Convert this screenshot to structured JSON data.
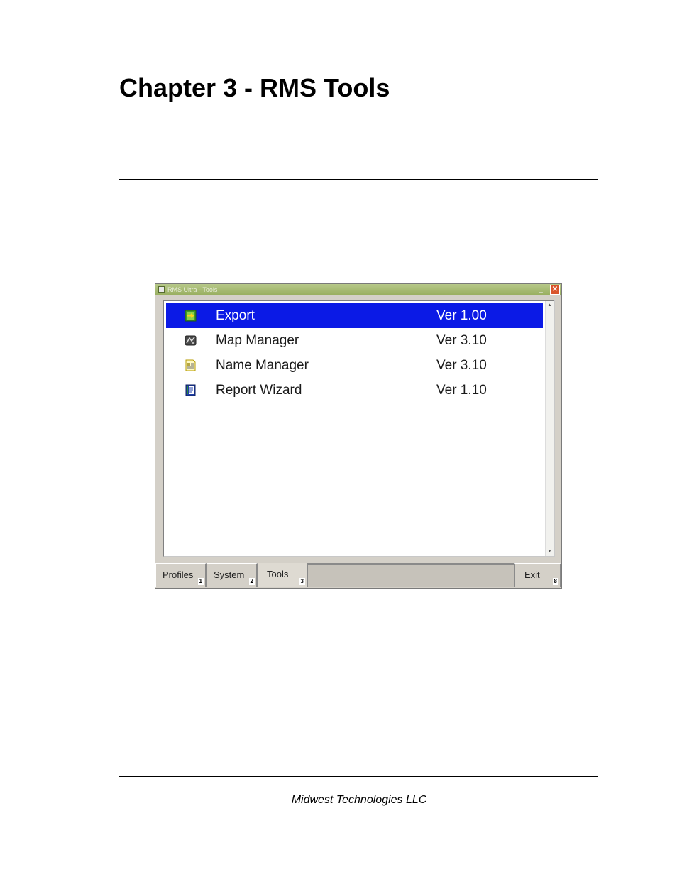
{
  "chapter": {
    "title": "Chapter 3 - RMS Tools"
  },
  "footer": {
    "text": "Midwest Technologies LLC"
  },
  "window": {
    "title": "RMS Ultra - Tools",
    "minimize_glyph": "_",
    "close_glyph": "✕",
    "accent_color": "#0b1ae6",
    "tools": [
      {
        "name": "Export",
        "version": "Ver 1.00",
        "icon": "export-icon",
        "selected": true
      },
      {
        "name": "Map Manager",
        "version": "Ver 3.10",
        "icon": "map-manager-icon",
        "selected": false
      },
      {
        "name": "Name Manager",
        "version": "Ver 3.10",
        "icon": "name-manager-icon",
        "selected": false
      },
      {
        "name": "Report Wizard",
        "version": "Ver 1.10",
        "icon": "report-wizard-icon",
        "selected": false
      }
    ],
    "tabs": [
      {
        "label": "Profiles",
        "key": "1"
      },
      {
        "label": "System",
        "key": "2"
      },
      {
        "label": "Tools",
        "key": "3",
        "active": true
      }
    ],
    "exit": {
      "label": "Exit",
      "key": "8"
    },
    "scroll_up_glyph": "▲",
    "scroll_down_glyph": "▼"
  }
}
